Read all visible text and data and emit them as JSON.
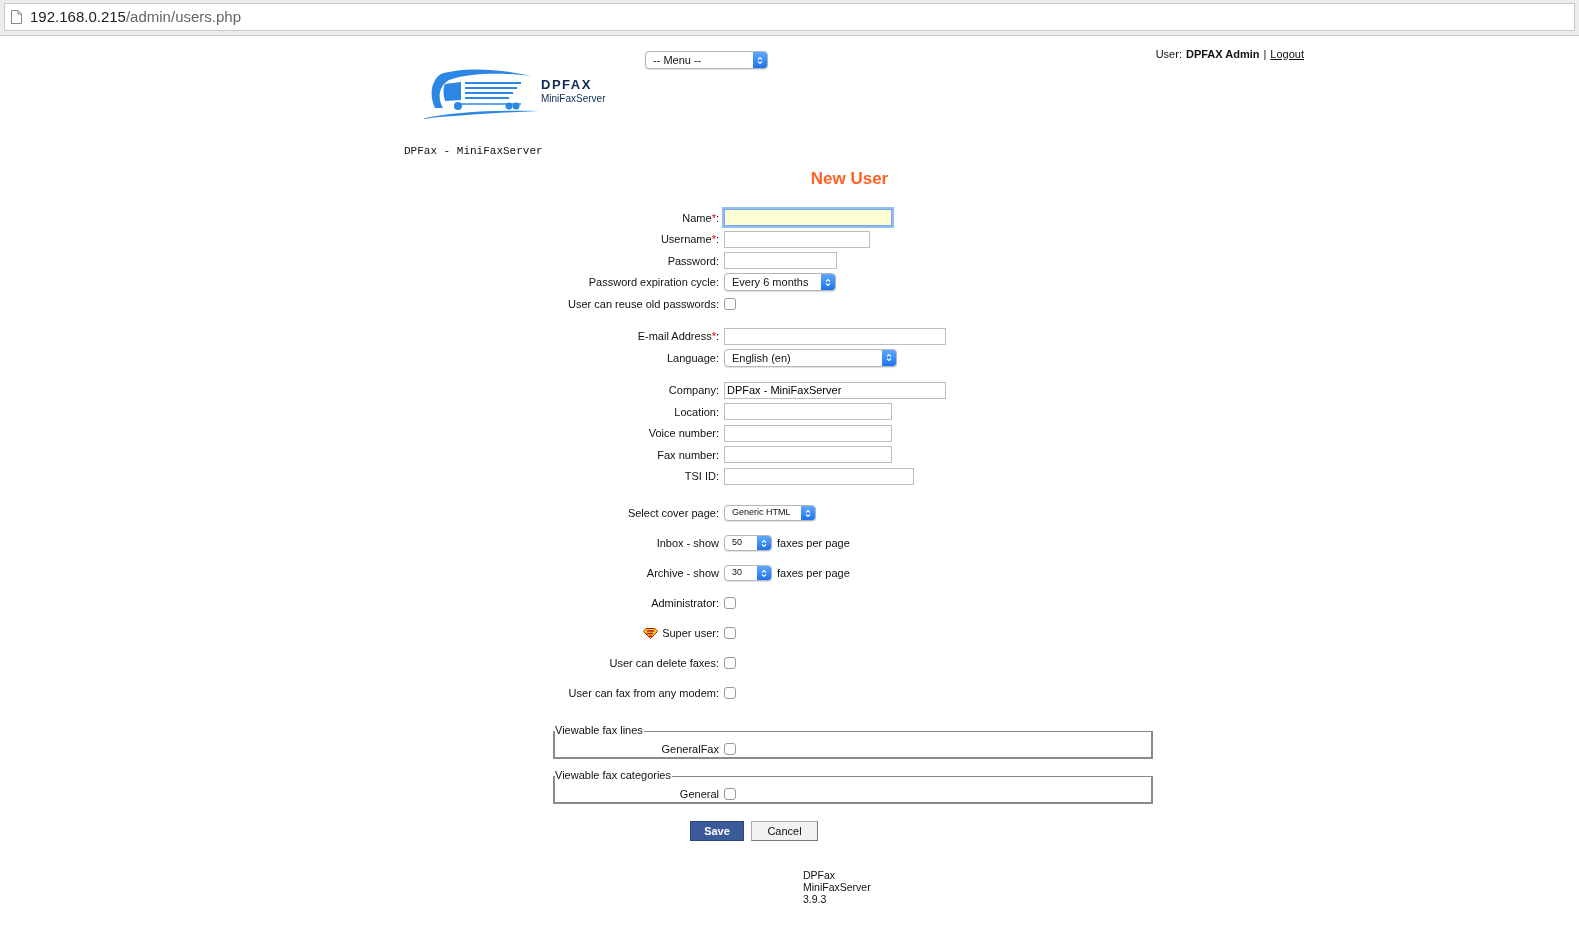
{
  "address_bar": {
    "host": "192.168.0.215",
    "path": "/admin/users.php"
  },
  "menu": {
    "value": "-- Menu --"
  },
  "user_info": {
    "label": "User:",
    "name": "DPFAX Admin",
    "separator": "|",
    "logout": "Logout"
  },
  "logo": {
    "title": "DPFAX",
    "subtitle": "MiniFaxServer"
  },
  "caption": "DPFax - MiniFaxServer",
  "heading": "New User",
  "sections": [
    {
      "fields": [
        {
          "kind": "text",
          "label": "Name",
          "required_mark": "*",
          "label_end": ":",
          "focused": true
        },
        {
          "kind": "text",
          "label": "Username",
          "required_mark": "*",
          "label_end": ":",
          "focused": false
        },
        {
          "kind": "text",
          "label": "Password:",
          "focused": false
        },
        {
          "kind": "select",
          "label": "Password expiration cycle:",
          "value": "Every 6 months"
        },
        {
          "kind": "checkbox",
          "label": "User can reuse old passwords:",
          "checked": false
        }
      ]
    },
    {
      "fields": [
        {
          "kind": "text",
          "label": "E-mail Address",
          "required_mark": "*",
          "label_end": ":",
          "focused": false
        },
        {
          "kind": "select",
          "label": "Language:",
          "value": "English (en)"
        }
      ]
    },
    {
      "fields": [
        {
          "kind": "text",
          "label": "Company:",
          "value": "DPFax - MiniFaxServer",
          "focused": false
        },
        {
          "kind": "text",
          "label": "Location:",
          "focused": false
        },
        {
          "kind": "text",
          "label": "Voice number:",
          "focused": false
        },
        {
          "kind": "text",
          "label": "Fax number:",
          "focused": false
        },
        {
          "kind": "text",
          "label": "TSI ID:",
          "focused": false
        }
      ]
    },
    {
      "fields": [
        {
          "kind": "select",
          "label": "Select cover page:",
          "value": "Generic HTML"
        },
        {
          "kind": "select",
          "label": "Inbox - show",
          "value": "50",
          "suffix": "faxes per page"
        },
        {
          "kind": "select",
          "label": "Archive - show",
          "value": "30",
          "suffix": "faxes per page"
        },
        {
          "kind": "checkbox",
          "label": "Administrator:",
          "checked": false
        },
        {
          "kind": "icon_checkbox",
          "label": "Super user:",
          "checked": false
        },
        {
          "kind": "checkbox",
          "label": "User can delete faxes:",
          "checked": false
        },
        {
          "kind": "checkbox",
          "label": "User can fax from any modem:",
          "checked": false
        }
      ]
    }
  ],
  "fieldsets": [
    {
      "legend": "Viewable fax lines",
      "items": [
        {
          "label": "GeneralFax",
          "checked": false
        }
      ]
    },
    {
      "legend": "Viewable fax categories",
      "items": [
        {
          "label": "General",
          "checked": false
        }
      ]
    }
  ],
  "buttons": [
    {
      "label": "Save",
      "kind": "primary"
    },
    {
      "label": "Cancel",
      "kind": "secondary"
    }
  ],
  "footer": [
    "DPFax",
    "MiniFaxServer",
    "3.9.3"
  ]
}
